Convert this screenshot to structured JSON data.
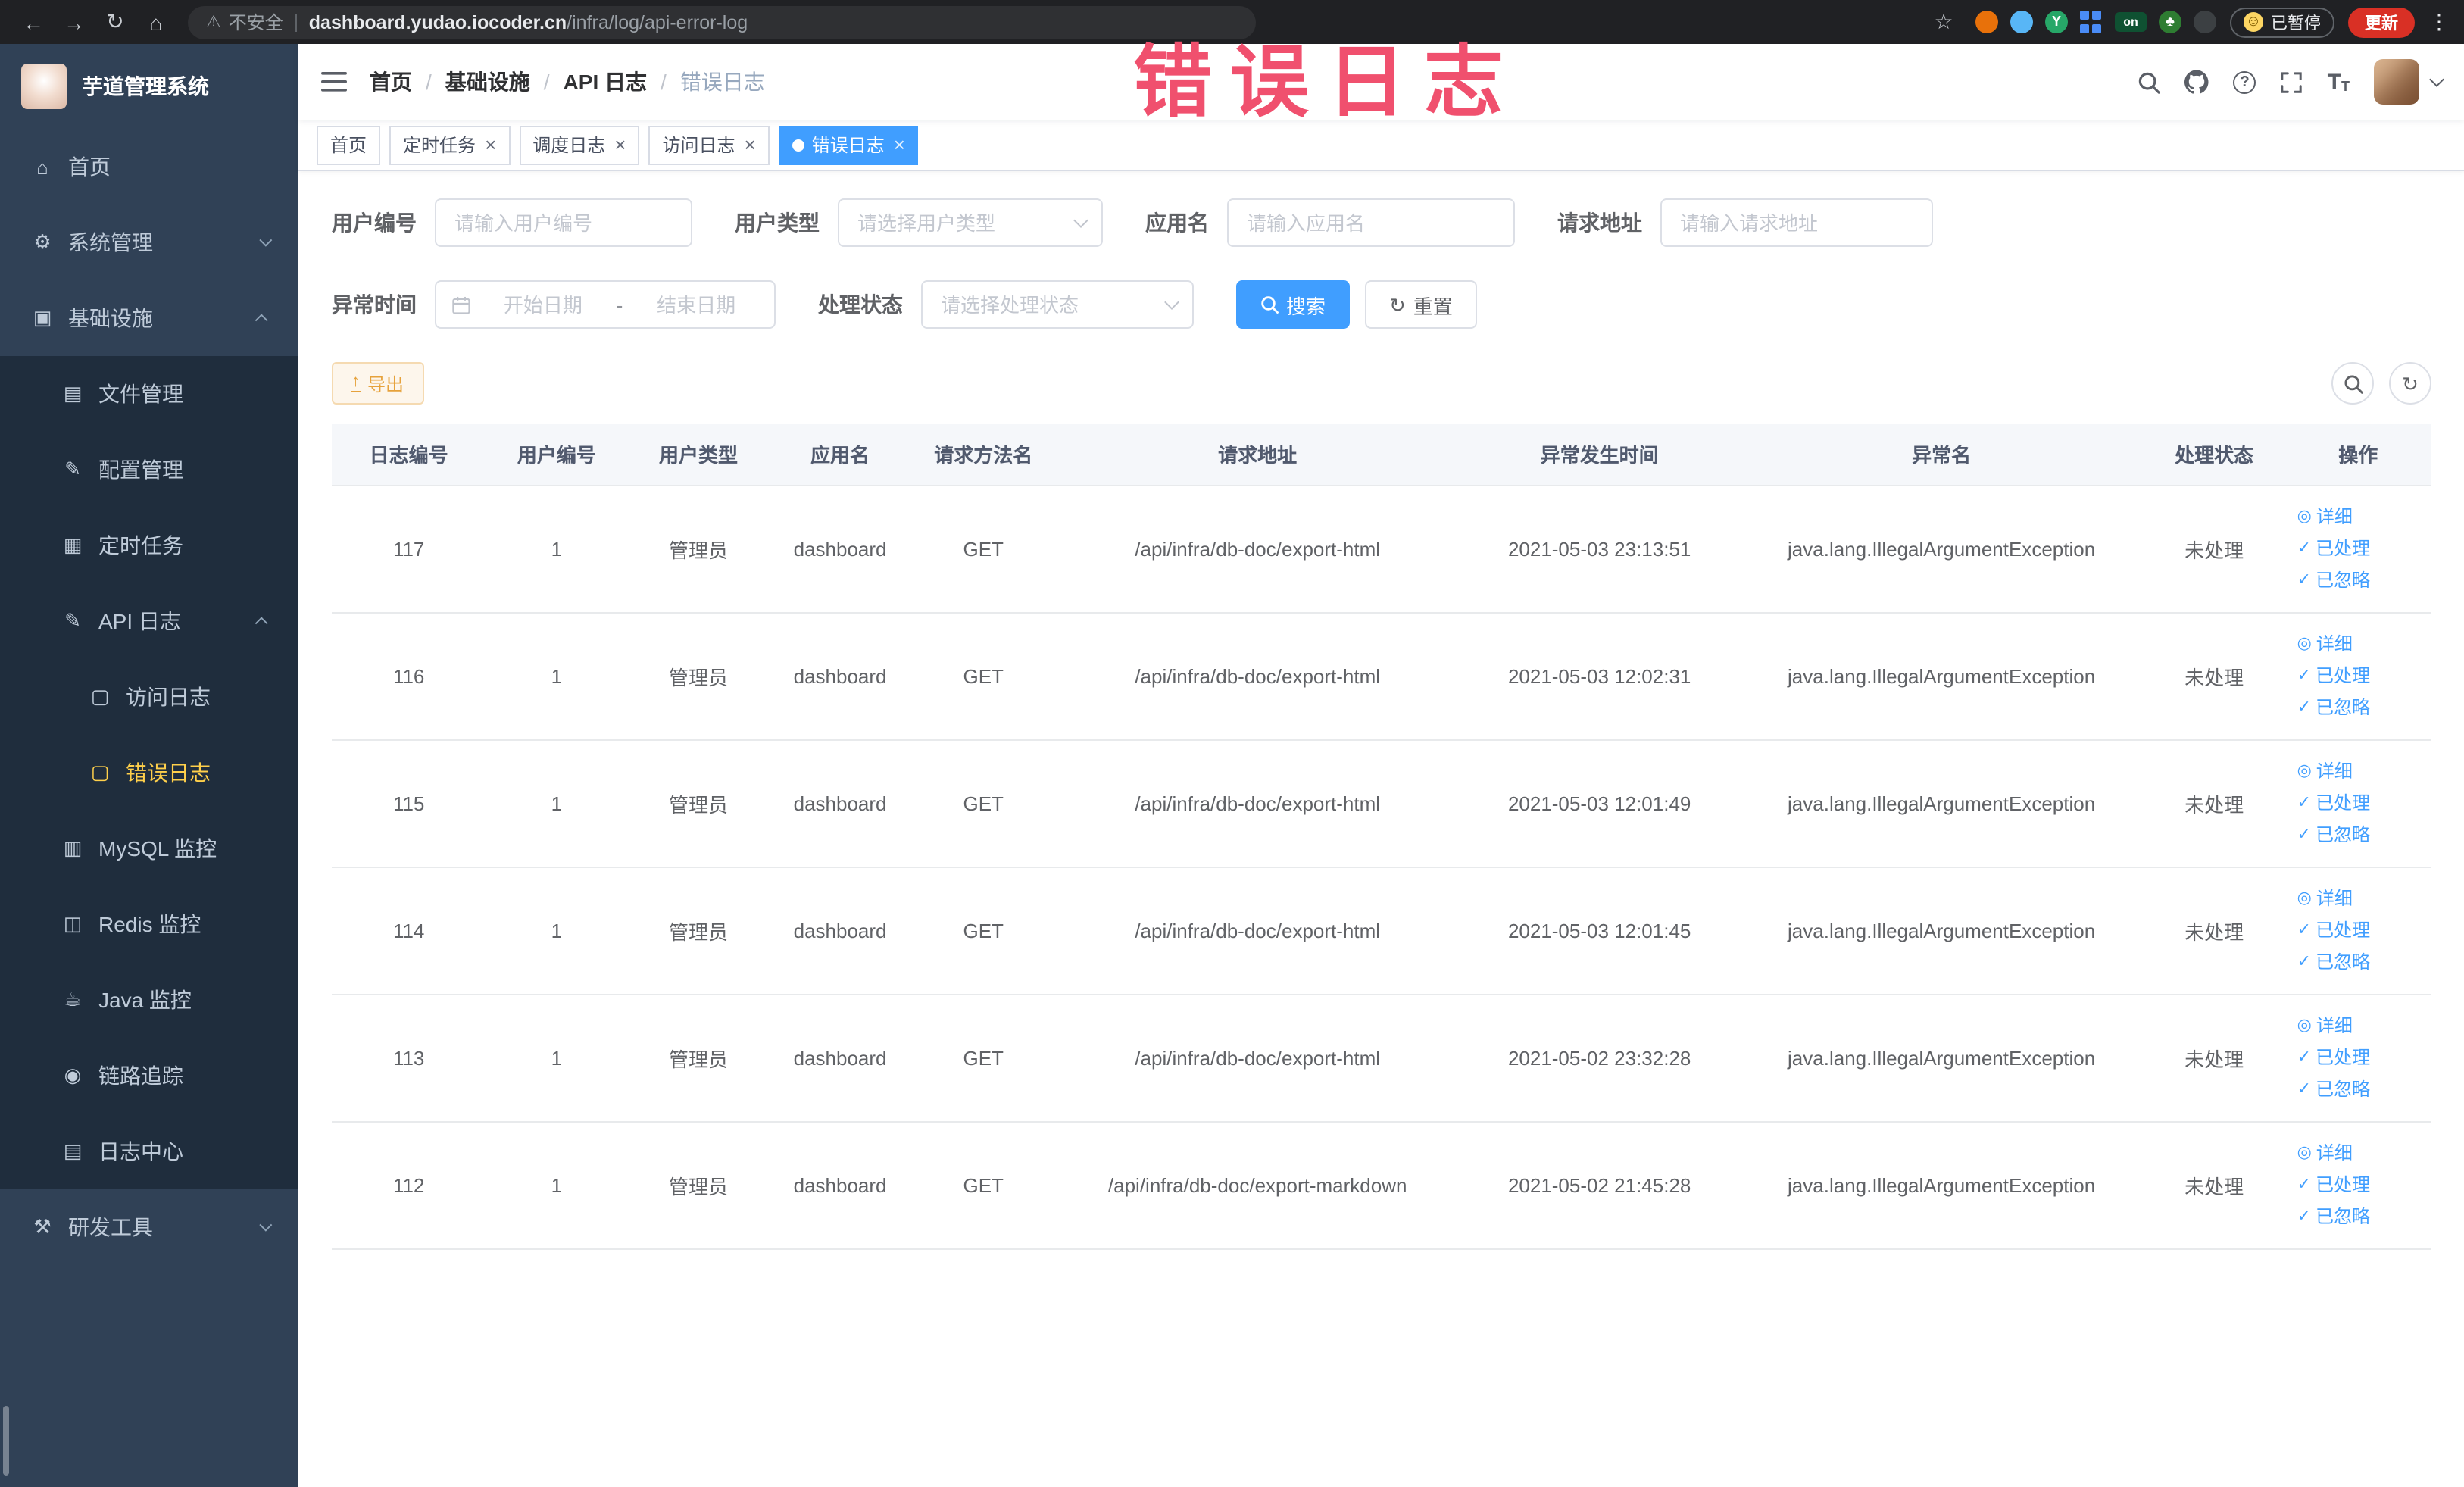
{
  "theme": {
    "primary": "#409eff",
    "sidebar_bg": "#304156",
    "submenu_bg": "#1f2d3d",
    "menu_active": "#ffd04b",
    "watermark": "#f0506e",
    "warning": "#e6a23c",
    "update_bg": "#d93025"
  },
  "browser": {
    "nav_icons": {
      "back": "←",
      "forward": "→",
      "reload": "↻",
      "home": "⌂",
      "warning": "⚠",
      "star": "☆",
      "menu": "⋮"
    },
    "security_label": "不安全",
    "url_domain": "dashboard.yudao.iocoder.cn",
    "url_path": "/infra/log/api-error-log",
    "extensions": [
      {
        "name": "ext-orange-ball-icon",
        "shape": "circle",
        "color": "#e8710a",
        "glyph": ""
      },
      {
        "name": "ext-blue-drop-icon",
        "shape": "circle",
        "color": "#58b6f6",
        "glyph": ""
      },
      {
        "name": "ext-green-y-icon",
        "shape": "circle",
        "color": "#27a768",
        "glyph": "Y"
      },
      {
        "name": "ext-blue-grid-icon",
        "shape": "grid",
        "color": "#4a8cf7",
        "glyph": ""
      },
      {
        "name": "ext-on-badge-icon",
        "shape": "badge",
        "color": "#0f5132",
        "glyph": "on"
      },
      {
        "name": "ext-green-tree-icon",
        "shape": "circle",
        "color": "#2e7d32",
        "glyph": "♣"
      },
      {
        "name": "ext-dark-pin-icon",
        "shape": "circle",
        "color": "#3c4043",
        "glyph": ""
      }
    ],
    "paused_badge": "已暂停",
    "update_button": "更新"
  },
  "sidebar": {
    "logo_title": "芋道管理系统",
    "items": [
      {
        "key": "home",
        "label": "首页",
        "icon": "home",
        "indent": 0
      },
      {
        "key": "system-management",
        "label": "系统管理",
        "icon": "gear",
        "indent": 0,
        "chevron": "down"
      },
      {
        "key": "infrastructure",
        "label": "基础设施",
        "icon": "infra",
        "indent": 0,
        "chevron": "up"
      },
      {
        "key": "file-management",
        "label": "文件管理",
        "icon": "file",
        "indent": 1,
        "sub": true
      },
      {
        "key": "config-management",
        "label": "配置管理",
        "icon": "config",
        "indent": 1,
        "sub": true
      },
      {
        "key": "scheduled-tasks",
        "label": "定时任务",
        "icon": "timer",
        "indent": 1,
        "sub": true
      },
      {
        "key": "api-logs",
        "label": "API 日志",
        "icon": "apilog",
        "indent": 1,
        "sub": true,
        "chevron": "up"
      },
      {
        "key": "access-log",
        "label": "访问日志",
        "icon": "doc",
        "indent": 2,
        "sub": true
      },
      {
        "key": "error-log",
        "label": "错误日志",
        "icon": "doc",
        "indent": 2,
        "sub": true,
        "active": true
      },
      {
        "key": "mysql-monitor",
        "label": "MySQL 监控",
        "icon": "mysql",
        "indent": 1,
        "sub": true
      },
      {
        "key": "redis-monitor",
        "label": "Redis 监控",
        "icon": "redis",
        "indent": 1,
        "sub": true
      },
      {
        "key": "java-monitor",
        "label": "Java 监控",
        "icon": "java",
        "indent": 1,
        "sub": true
      },
      {
        "key": "trace",
        "label": "链路追踪",
        "icon": "trace",
        "indent": 1,
        "sub": true
      },
      {
        "key": "log-center",
        "label": "日志中心",
        "icon": "logcenter",
        "indent": 1,
        "sub": true
      },
      {
        "key": "dev-tools",
        "label": "研发工具",
        "icon": "tools",
        "indent": 0,
        "chevron": "down"
      }
    ]
  },
  "topbar": {
    "breadcrumb": [
      "首页",
      "基础设施",
      "API 日志",
      "错误日志"
    ],
    "separator": "/"
  },
  "tabs": [
    {
      "key": "home",
      "label": "首页",
      "closable": false,
      "active": false
    },
    {
      "key": "scheduled-tasks",
      "label": "定时任务",
      "closable": true,
      "active": false
    },
    {
      "key": "schedule-log",
      "label": "调度日志",
      "closable": true,
      "active": false
    },
    {
      "key": "access-log",
      "label": "访问日志",
      "closable": true,
      "active": false
    },
    {
      "key": "error-log",
      "label": "错误日志",
      "closable": true,
      "active": true
    }
  ],
  "overlay": {
    "watermark": "错误日志"
  },
  "filters": {
    "user_id": {
      "label": "用户编号",
      "placeholder": "请输入用户编号"
    },
    "user_type": {
      "label": "用户类型",
      "placeholder": "请选择用户类型"
    },
    "app_name": {
      "label": "应用名",
      "placeholder": "请输入应用名"
    },
    "request_url": {
      "label": "请求地址",
      "placeholder": "请输入请求地址"
    },
    "exception_time": {
      "label": "异常时间",
      "start_placeholder": "开始日期",
      "separator": "-",
      "end_placeholder": "结束日期"
    },
    "process_status": {
      "label": "处理状态",
      "placeholder": "请选择处理状态"
    },
    "search_button": "搜索",
    "reset_button": "重置"
  },
  "toolbar": {
    "export_button": "导出"
  },
  "table": {
    "columns": [
      "日志编号",
      "用户编号",
      "用户类型",
      "应用名",
      "请求方法名",
      "请求地址",
      "异常发生时间",
      "异常名",
      "处理状态",
      "操作"
    ],
    "rows": [
      {
        "id": "117",
        "user_id": "1",
        "user_type": "管理员",
        "app_name": "dashboard",
        "method": "GET",
        "url": "/api/infra/db-doc/export-html",
        "time": "2021-05-03 23:13:51",
        "exception": "java.lang.IllegalArgumentException",
        "status": "未处理"
      },
      {
        "id": "116",
        "user_id": "1",
        "user_type": "管理员",
        "app_name": "dashboard",
        "method": "GET",
        "url": "/api/infra/db-doc/export-html",
        "time": "2021-05-03 12:02:31",
        "exception": "java.lang.IllegalArgumentException",
        "status": "未处理"
      },
      {
        "id": "115",
        "user_id": "1",
        "user_type": "管理员",
        "app_name": "dashboard",
        "method": "GET",
        "url": "/api/infra/db-doc/export-html",
        "time": "2021-05-03 12:01:49",
        "exception": "java.lang.IllegalArgumentException",
        "status": "未处理"
      },
      {
        "id": "114",
        "user_id": "1",
        "user_type": "管理员",
        "app_name": "dashboard",
        "method": "GET",
        "url": "/api/infra/db-doc/export-html",
        "time": "2021-05-03 12:01:45",
        "exception": "java.lang.IllegalArgumentException",
        "status": "未处理"
      },
      {
        "id": "113",
        "user_id": "1",
        "user_type": "管理员",
        "app_name": "dashboard",
        "method": "GET",
        "url": "/api/infra/db-doc/export-html",
        "time": "2021-05-02 23:32:28",
        "exception": "java.lang.IllegalArgumentException",
        "status": "未处理"
      },
      {
        "id": "112",
        "user_id": "1",
        "user_type": "管理员",
        "app_name": "dashboard",
        "method": "GET",
        "url": "/api/infra/db-doc/export-markdown",
        "time": "2021-05-02 21:45:28",
        "exception": "java.lang.IllegalArgumentException",
        "status": "未处理"
      }
    ],
    "row_actions": [
      {
        "key": "detail",
        "icon": "eye",
        "label": "详细"
      },
      {
        "key": "mark-processed",
        "icon": "check",
        "label": "已处理"
      },
      {
        "key": "mark-ignored",
        "icon": "check",
        "label": "已忽略"
      }
    ]
  }
}
